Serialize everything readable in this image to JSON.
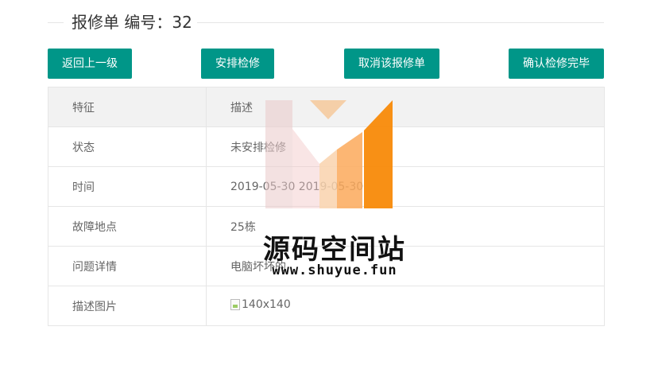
{
  "header": {
    "title": "报修单 编号：32"
  },
  "toolbar": {
    "back_label": "返回上一级",
    "arrange_label": "安排检修",
    "cancel_label": "取消该报修单",
    "finish_label": "确认检修完毕"
  },
  "table": {
    "headers": [
      "特征",
      "描述"
    ],
    "rows": [
      {
        "feature": "状态",
        "value": "未安排检修"
      },
      {
        "feature": "时间",
        "value": "2019-05-30 2019-05-30"
      },
      {
        "feature": "故障地点",
        "value": "25栋"
      },
      {
        "feature": "问题详情",
        "value": "电脑坏坏的"
      },
      {
        "feature": "描述图片",
        "value": "140x140"
      }
    ]
  },
  "watermark": {
    "name": "源码空间站",
    "url": "www.shuyue.fun"
  },
  "colors": {
    "primary": "#009688",
    "border": "#e6e6e6",
    "header_bg": "#f2f2f2",
    "watermark_orange": "#f7931e"
  }
}
